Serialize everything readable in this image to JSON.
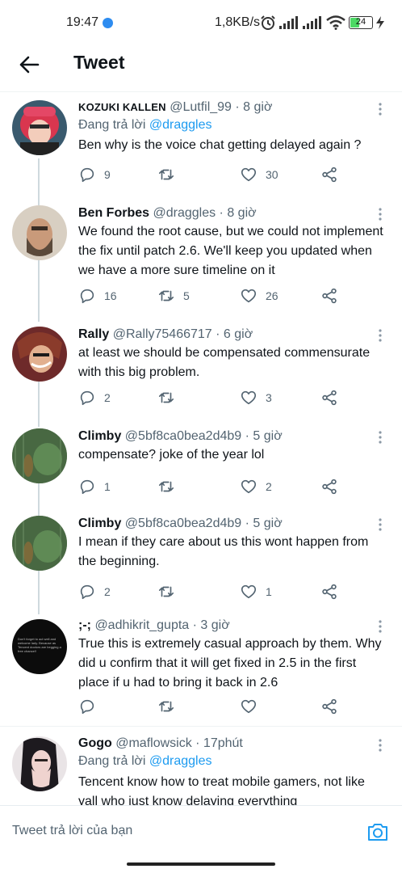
{
  "status_bar": {
    "time": "19:47",
    "network_speed": "1,8KB/s",
    "battery": "24"
  },
  "header": {
    "title": "Tweet"
  },
  "tweets": [
    {
      "name": "KOZUKI KALLEN",
      "handle": "@Lutfil_99",
      "time": "· 8 giờ",
      "reply_prefix": "Đang trả lời",
      "reply_to": "@draggles",
      "text": "Ben why is the voice chat getting delayed again ?",
      "replies": "9",
      "retweets": "",
      "likes": "30"
    },
    {
      "name": "Ben Forbes",
      "handle": "@draggles",
      "time": "· 8 giờ",
      "text": "We found the root cause, but we could not implement the fix until patch 2.6. We'll keep you updated when we have a more sure timeline on it",
      "replies": "16",
      "retweets": "5",
      "likes": "26"
    },
    {
      "name": "Rally",
      "handle": "@Rally75466717",
      "time": "· 6 giờ",
      "text": "at least we should be compensated commensurate with this big problem.",
      "replies": "2",
      "retweets": "",
      "likes": "3"
    },
    {
      "name": "Climby",
      "handle": "@5bf8ca0bea2d4b9",
      "time": "· 5 giờ",
      "text": "compensate? joke of the year lol",
      "replies": "1",
      "retweets": "",
      "likes": "2"
    },
    {
      "name": "Climby",
      "handle": "@5bf8ca0bea2d4b9",
      "time": "· 5 giờ",
      "text": "I mean if they care about us this wont happen from the beginning.",
      "replies": "2",
      "retweets": "",
      "likes": "1"
    },
    {
      "name": ";-;",
      "handle": "@adhikrit_gupta",
      "time": "· 3 giờ",
      "text": "True this is extremely casual approach by them. Why did u confirm that it will get fixed in 2.5 in the first place if u had to bring it back in 2.6",
      "replies": "",
      "retweets": "",
      "likes": "",
      "avatar_text": "Don't forget to act well and welcome lady. Because as Tencent doctors are begging a free chance!!"
    },
    {
      "name": "Gogo",
      "handle": "@maflowsick",
      "time": "· 17phút",
      "reply_prefix": "Đang trả lời",
      "reply_to": "@draggles",
      "text": "Tencent know how to treat mobile gamers, not like yall who just know delaying everything"
    }
  ],
  "composer": {
    "placeholder": "Tweet trả lời của bạn"
  },
  "colors": {
    "accent": "#1d9bf0",
    "text": "#0f1419",
    "secondary": "#536471",
    "thread_line": "#cfd9de"
  }
}
